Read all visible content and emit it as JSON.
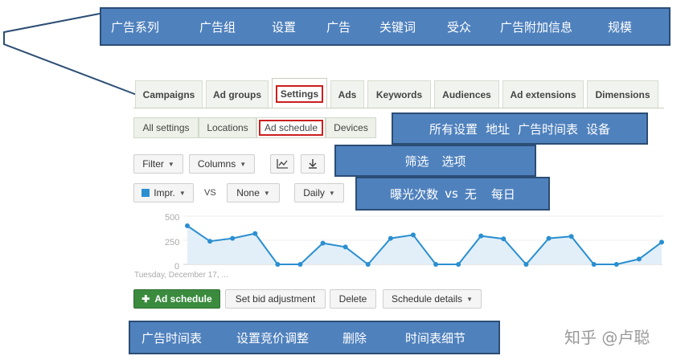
{
  "callouts": {
    "tabs": [
      "广告系列",
      "广告组",
      "设置",
      "广告",
      "关键词",
      "受众",
      "广告附加信息",
      "规模"
    ],
    "subtabs": [
      "所有设置",
      "地址",
      "广告时间表",
      "设备"
    ],
    "filter": [
      "筛选",
      "选项"
    ],
    "impr": [
      "曝光次数",
      "vs",
      "无",
      "每日"
    ],
    "actions": [
      "广告时间表",
      "设置竞价调整",
      "删除",
      "时间表细节"
    ]
  },
  "tabs": [
    "Campaigns",
    "Ad groups",
    "Settings",
    "Ads",
    "Keywords",
    "Audiences",
    "Ad extensions",
    "Dimensions"
  ],
  "active_tab": "Settings",
  "subtabs": [
    "All settings",
    "Locations",
    "Ad schedule",
    "Devices"
  ],
  "active_subtab": "Ad schedule",
  "toolbar": {
    "filter_label": "Filter",
    "columns_label": "Columns",
    "chart_icon": "line-chart-icon",
    "download_icon": "download-icon"
  },
  "metrics": {
    "metric1": "Impr.",
    "vs": "VS",
    "metric2": "None",
    "interval": "Daily",
    "metric1_color": "#2b8fd0"
  },
  "chart_data": {
    "type": "area",
    "y_ticks": [
      "500",
      "250",
      "0"
    ],
    "ylim": [
      0,
      500
    ],
    "start_label": "Tuesday, December 17, ...",
    "values": [
      400,
      240,
      270,
      320,
      0,
      0,
      220,
      180,
      0,
      270,
      305,
      0,
      0,
      295,
      265,
      0,
      270,
      290,
      0,
      0,
      55,
      230
    ],
    "line_color": "#2b8fd0",
    "fill_color": "#e2eff8"
  },
  "actions": {
    "add_label": "Ad schedule",
    "bid_label": "Set bid adjustment",
    "delete_label": "Delete",
    "details_label": "Schedule details"
  },
  "watermark": "知乎 @卢聪"
}
